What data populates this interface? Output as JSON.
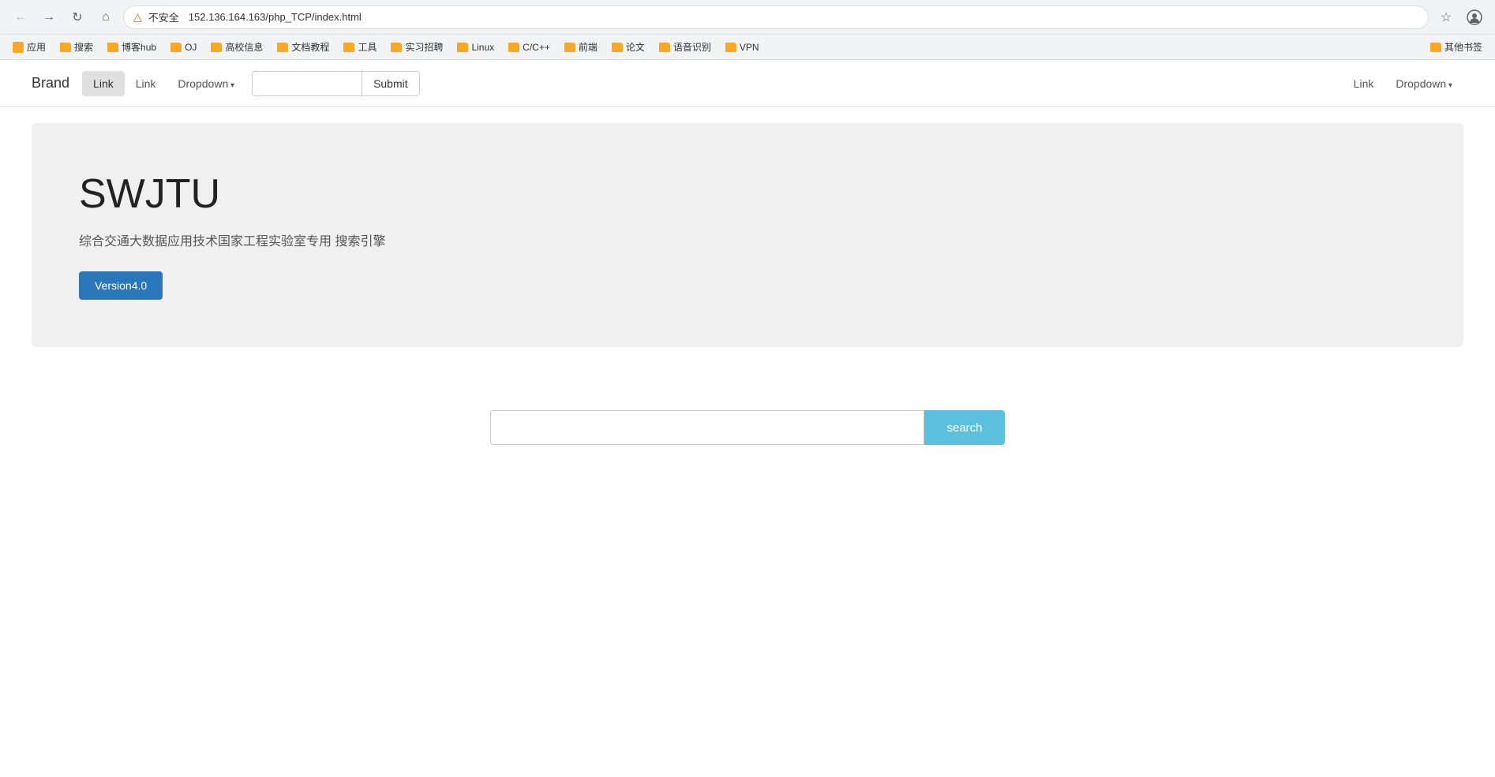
{
  "browser": {
    "address": "152.136.164.163/php_TCP/index.html",
    "warning_label": "不安全",
    "warning_symbol": "▲"
  },
  "bookmarks": {
    "items": [
      {
        "label": "应用",
        "type": "folder"
      },
      {
        "label": "搜索",
        "type": "folder"
      },
      {
        "label": "博客hub",
        "type": "folder"
      },
      {
        "label": "OJ",
        "type": "folder"
      },
      {
        "label": "高校信息",
        "type": "folder"
      },
      {
        "label": "文档教程",
        "type": "folder"
      },
      {
        "label": "工具",
        "type": "folder"
      },
      {
        "label": "实习招聘",
        "type": "folder"
      },
      {
        "label": "Linux",
        "type": "folder"
      },
      {
        "label": "C/C++",
        "type": "folder"
      },
      {
        "label": "前端",
        "type": "folder"
      },
      {
        "label": "论文",
        "type": "folder"
      },
      {
        "label": "语音识别",
        "type": "folder"
      },
      {
        "label": "VPN",
        "type": "folder"
      },
      {
        "label": "其他书签",
        "type": "folder"
      }
    ]
  },
  "navbar": {
    "brand": "Brand",
    "nav_items": [
      {
        "label": "Link",
        "active": true
      },
      {
        "label": "Link",
        "active": false
      },
      {
        "label": "Dropdown",
        "dropdown": true
      }
    ],
    "right_items": [
      {
        "label": "Link",
        "active": false
      },
      {
        "label": "Dropdown",
        "dropdown": true
      }
    ],
    "form_placeholder": "",
    "submit_label": "Submit"
  },
  "hero": {
    "title": "SWJTU",
    "subtitle": "综合交通大数据应用技术国家工程实验室专用 搜索引擎",
    "button_label": "Version4.0"
  },
  "search": {
    "placeholder": "",
    "button_label": "search"
  }
}
